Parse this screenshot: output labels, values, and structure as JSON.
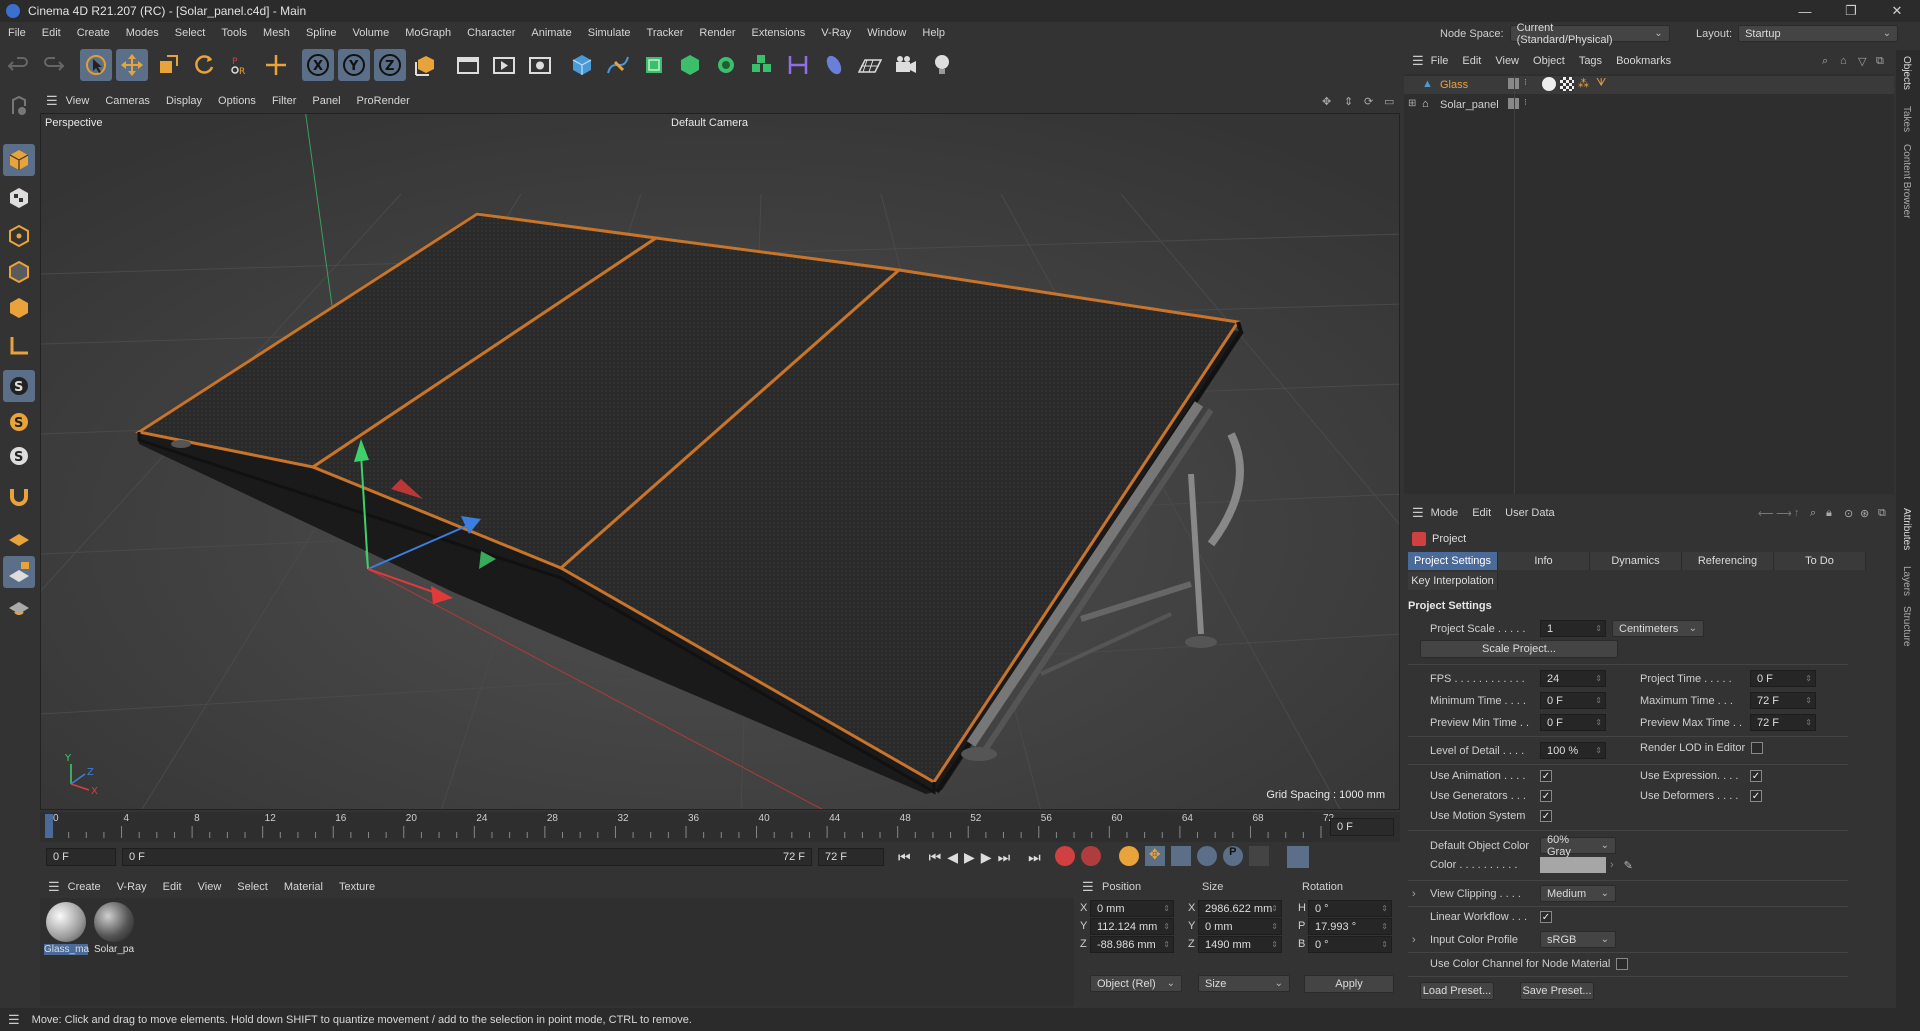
{
  "window": {
    "title": "Cinema 4D R21.207 (RC) - [Solar_panel.c4d] - Main"
  },
  "menu": [
    "File",
    "Edit",
    "Create",
    "Modes",
    "Select",
    "Tools",
    "Mesh",
    "Spline",
    "Volume",
    "MoGraph",
    "Character",
    "Animate",
    "Simulate",
    "Tracker",
    "Render",
    "Extensions",
    "V-Ray",
    "Window",
    "Help"
  ],
  "node_space": {
    "label": "Node Space:",
    "value": "Current (Standard/Physical)"
  },
  "layout": {
    "label": "Layout:",
    "value": "Startup"
  },
  "toolbar": {
    "axis_x": "X",
    "axis_y": "Y",
    "axis_z": "Z"
  },
  "viewport": {
    "menu": [
      "View",
      "Cameras",
      "Display",
      "Options",
      "Filter",
      "Panel",
      "ProRender"
    ],
    "label": "Perspective",
    "camera": "Default Camera",
    "grid_spacing": "Grid Spacing : 1000 mm",
    "axis_x": "X",
    "axis_y": "Y",
    "axis_z": "Z"
  },
  "timeline": {
    "ticks": [
      "0",
      "4",
      "8",
      "12",
      "16",
      "20",
      "24",
      "28",
      "32",
      "36",
      "40",
      "44",
      "48",
      "52",
      "56",
      "60",
      "64",
      "68",
      "72"
    ],
    "current_frame": "0 F"
  },
  "transport": {
    "start": "0 F",
    "range_start": "0 F",
    "range_end": "72 F",
    "end": "72 F"
  },
  "material_panel": {
    "menu": [
      "Create",
      "V-Ray",
      "Edit",
      "View",
      "Select",
      "Material",
      "Texture"
    ],
    "materials": [
      {
        "name": "Glass_ma"
      },
      {
        "name": "Solar_pa"
      }
    ]
  },
  "coords": {
    "headers": {
      "position": "Position",
      "size": "Size",
      "rotation": "Rotation"
    },
    "rows": [
      {
        "axis": "X",
        "pos": "0 mm",
        "size_axis": "X",
        "size": "2986.622 mm",
        "rot_axis": "H",
        "rot": "0 °"
      },
      {
        "axis": "Y",
        "pos": "112.124 mm",
        "size_axis": "Y",
        "size": "0 mm",
        "rot_axis": "P",
        "rot": "17.993 °"
      },
      {
        "axis": "Z",
        "pos": "-88.986 mm",
        "size_axis": "Z",
        "size": "1490 mm",
        "rot_axis": "B",
        "rot": "0 °"
      }
    ],
    "mode": "Object (Rel)",
    "size_mode": "Size",
    "apply": "Apply"
  },
  "status": "Move: Click and drag to move elements. Hold down SHIFT to quantize movement / add to the selection in point mode, CTRL to remove.",
  "object_manager": {
    "menu": [
      "File",
      "Edit",
      "View",
      "Object",
      "Tags",
      "Bookmarks"
    ],
    "objects": [
      {
        "name": "Glass",
        "color": "#e8a33a"
      },
      {
        "name": "Solar_panel",
        "color": "#cfcfcf"
      }
    ]
  },
  "side_tabs": {
    "top": [
      "Objects",
      "Takes",
      "Content Browser"
    ],
    "bottom": [
      "Attributes",
      "Layers",
      "Structure"
    ]
  },
  "attributes": {
    "menu": [
      "Mode",
      "Edit",
      "User Data"
    ],
    "title": "Project",
    "tabs": [
      "Project Settings",
      "Info",
      "Dynamics",
      "Referencing",
      "To Do"
    ],
    "tab2": "Key Interpolation",
    "section": "Project Settings",
    "project_scale": {
      "label": "Project Scale . . . . .",
      "value": "1",
      "unit": "Centimeters"
    },
    "scale_button": "Scale Project...",
    "fps": {
      "label": "FPS . . . . . . . . . . . .",
      "value": "24"
    },
    "project_time": {
      "label": "Project Time . . . . .",
      "value": "0 F"
    },
    "min_time": {
      "label": "Minimum Time . . . .",
      "value": "0 F"
    },
    "max_time": {
      "label": "Maximum Time . . .",
      "value": "72 F"
    },
    "prev_min": {
      "label": "Preview Min Time . .",
      "value": "0 F"
    },
    "prev_max": {
      "label": "Preview Max Time . .",
      "value": "72 F"
    },
    "lod": {
      "label": "Level of Detail . . . .",
      "value": "100 %"
    },
    "render_lod": "Render LOD in Editor",
    "use_animation": "Use Animation . . . .",
    "use_expression": "Use Expression. . . .",
    "use_generators": "Use Generators . . .",
    "use_deformers": "Use Deformers . . . .",
    "use_motion": "Use Motion System",
    "default_color": {
      "label": "Default Object Color",
      "value": "60% Gray"
    },
    "color_label": "Color . . . . . . . . . .",
    "view_clipping": {
      "label": "View Clipping . . . .",
      "value": "Medium"
    },
    "linear_workflow": "Linear Workflow . . .",
    "input_profile": {
      "label": "Input Color Profile",
      "value": "sRGB"
    },
    "use_color_channel": "Use Color Channel for Node Material",
    "load_preset": "Load Preset...",
    "save_preset": "Save Preset..."
  }
}
